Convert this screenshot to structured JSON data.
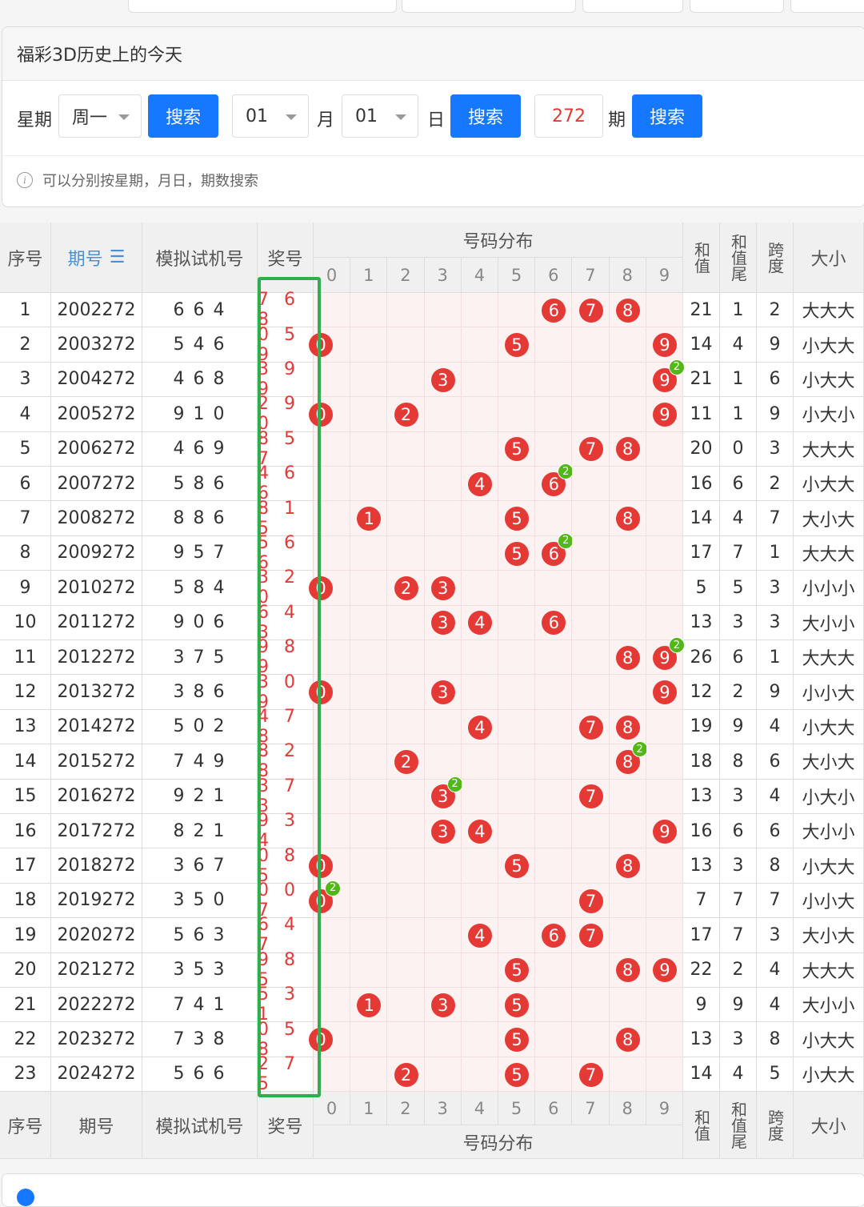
{
  "panel": {
    "title": "福彩3D历史上的今天",
    "weekday_label": "星期",
    "weekday_value": "周一",
    "search_label": "搜索",
    "month_value": "01",
    "month_label": "月",
    "day_value": "01",
    "day_label": "日",
    "issue_value": "272",
    "issue_label": "期",
    "hint": "可以分别按星期，月日，期数搜索"
  },
  "table": {
    "headers": {
      "index": "序号",
      "issue": "期号",
      "sim": "模拟试机号",
      "prize": "奖号",
      "dist": "号码分布",
      "sum": "和值",
      "sum_tail": "和值尾",
      "span": "跨度",
      "size": "大小"
    },
    "digits": [
      "0",
      "1",
      "2",
      "3",
      "4",
      "5",
      "6",
      "7",
      "8",
      "9"
    ],
    "rows": [
      {
        "idx": "1",
        "issue": "2002272",
        "sim": "6 6 4",
        "prize": "7 6 8",
        "d": [
          7,
          6,
          8
        ],
        "sum": "21",
        "tail": "1",
        "span": "2",
        "size": "大大大"
      },
      {
        "idx": "2",
        "issue": "2003272",
        "sim": "5 4 6",
        "prize": "0 5 9",
        "d": [
          0,
          5,
          9
        ],
        "sum": "14",
        "tail": "4",
        "span": "9",
        "size": "小大大"
      },
      {
        "idx": "3",
        "issue": "2004272",
        "sim": "4 6 8",
        "prize": "3 9 9",
        "d": [
          3,
          9,
          9
        ],
        "sum": "21",
        "tail": "1",
        "span": "6",
        "size": "小大大"
      },
      {
        "idx": "4",
        "issue": "2005272",
        "sim": "9 1 0",
        "prize": "2 9 0",
        "d": [
          2,
          9,
          0
        ],
        "sum": "11",
        "tail": "1",
        "span": "9",
        "size": "小大小"
      },
      {
        "idx": "5",
        "issue": "2006272",
        "sim": "4 6 9",
        "prize": "8 5 7",
        "d": [
          8,
          5,
          7
        ],
        "sum": "20",
        "tail": "0",
        "span": "3",
        "size": "大大大"
      },
      {
        "idx": "6",
        "issue": "2007272",
        "sim": "5 8 6",
        "prize": "4 6 6",
        "d": [
          4,
          6,
          6
        ],
        "sum": "16",
        "tail": "6",
        "span": "2",
        "size": "小大大"
      },
      {
        "idx": "7",
        "issue": "2008272",
        "sim": "8 8 6",
        "prize": "8 1 5",
        "d": [
          8,
          1,
          5
        ],
        "sum": "14",
        "tail": "4",
        "span": "7",
        "size": "大小大"
      },
      {
        "idx": "8",
        "issue": "2009272",
        "sim": "9 5 7",
        "prize": "5 6 6",
        "d": [
          5,
          6,
          6
        ],
        "sum": "17",
        "tail": "7",
        "span": "1",
        "size": "大大大"
      },
      {
        "idx": "9",
        "issue": "2010272",
        "sim": "5 8 4",
        "prize": "3 2 0",
        "d": [
          3,
          2,
          0
        ],
        "sum": "5",
        "tail": "5",
        "span": "3",
        "size": "小小小"
      },
      {
        "idx": "10",
        "issue": "2011272",
        "sim": "9 0 6",
        "prize": "6 4 3",
        "d": [
          6,
          4,
          3
        ],
        "sum": "13",
        "tail": "3",
        "span": "3",
        "size": "大小小"
      },
      {
        "idx": "11",
        "issue": "2012272",
        "sim": "3 7 5",
        "prize": "9 8 9",
        "d": [
          9,
          8,
          9
        ],
        "sum": "26",
        "tail": "6",
        "span": "1",
        "size": "大大大"
      },
      {
        "idx": "12",
        "issue": "2013272",
        "sim": "3 8 6",
        "prize": "3 0 9",
        "d": [
          3,
          0,
          9
        ],
        "sum": "12",
        "tail": "2",
        "span": "9",
        "size": "小小大"
      },
      {
        "idx": "13",
        "issue": "2014272",
        "sim": "5 0 2",
        "prize": "4 7 8",
        "d": [
          4,
          7,
          8
        ],
        "sum": "19",
        "tail": "9",
        "span": "4",
        "size": "小大大"
      },
      {
        "idx": "14",
        "issue": "2015272",
        "sim": "7 4 9",
        "prize": "8 2 8",
        "d": [
          8,
          2,
          8
        ],
        "sum": "18",
        "tail": "8",
        "span": "6",
        "size": "大小大"
      },
      {
        "idx": "15",
        "issue": "2016272",
        "sim": "9 2 1",
        "prize": "3 7 3",
        "d": [
          3,
          7,
          3
        ],
        "sum": "13",
        "tail": "3",
        "span": "4",
        "size": "小大小"
      },
      {
        "idx": "16",
        "issue": "2017272",
        "sim": "8 2 1",
        "prize": "9 3 4",
        "d": [
          9,
          3,
          4
        ],
        "sum": "16",
        "tail": "6",
        "span": "6",
        "size": "大小小"
      },
      {
        "idx": "17",
        "issue": "2018272",
        "sim": "3 6 7",
        "prize": "0 8 5",
        "d": [
          0,
          8,
          5
        ],
        "sum": "13",
        "tail": "3",
        "span": "8",
        "size": "小大大"
      },
      {
        "idx": "18",
        "issue": "2019272",
        "sim": "3 5 0",
        "prize": "0 0 7",
        "d": [
          0,
          0,
          7
        ],
        "sum": "7",
        "tail": "7",
        "span": "7",
        "size": "小小大"
      },
      {
        "idx": "19",
        "issue": "2020272",
        "sim": "5 6 3",
        "prize": "6 4 7",
        "d": [
          6,
          4,
          7
        ],
        "sum": "17",
        "tail": "7",
        "span": "3",
        "size": "大小大"
      },
      {
        "idx": "20",
        "issue": "2021272",
        "sim": "3 5 3",
        "prize": "9 8 5",
        "d": [
          9,
          8,
          5
        ],
        "sum": "22",
        "tail": "2",
        "span": "4",
        "size": "大大大"
      },
      {
        "idx": "21",
        "issue": "2022272",
        "sim": "7 4 1",
        "prize": "5 3 1",
        "d": [
          5,
          3,
          1
        ],
        "sum": "9",
        "tail": "9",
        "span": "4",
        "size": "大小小"
      },
      {
        "idx": "22",
        "issue": "2023272",
        "sim": "7 3 8",
        "prize": "0 5 8",
        "d": [
          0,
          5,
          8
        ],
        "sum": "13",
        "tail": "3",
        "span": "8",
        "size": "小大大"
      },
      {
        "idx": "23",
        "issue": "2024272",
        "sim": "5 6 6",
        "prize": "2 7 5",
        "d": [
          2,
          7,
          5
        ],
        "sum": "14",
        "tail": "4",
        "span": "5",
        "size": "小大大"
      }
    ]
  }
}
